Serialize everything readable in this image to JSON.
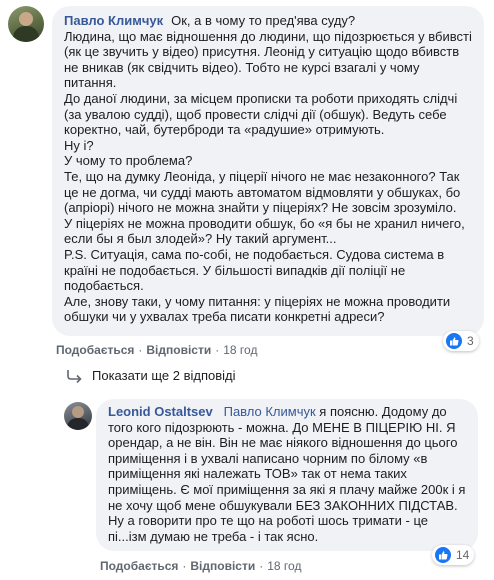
{
  "comment1": {
    "author": "Павло Климчук",
    "text": "Ок, а в чому то пред'ява суду?\nЛюдина, що має відношення до людини, що підозрюється у вбивсті (як це звучить у відео) присутня. Леонід у ситуацію щодо вбивств не вникав (як свідчить відео). Тобто не курсі взагалі у чому питання.\nДо даної людини, за місцем прописки та роботи приходять слідчі (за увалою судді), щоб провести слідчі дії (обшук). Ведуть себе коректно, чай, бутерброди та «радушие» отримують.\nНу і?\nУ чому то проблема?\nТе, що на думку Леоніда, у піцерії нічого не має незаконного? Так це не догма, чи судді мають автоматом відмовляти у обшуках, бо (апріорі) нічого не можна знайти у піцеріях? Не зовсім зрозуміло.\nУ піцеріях не можна проводити обшук, бо «я бы не хранил ничего, если бы я был злодей»? Ну такий аргумент...\nP.S. Ситуація, сама по-собі, не подобається. Судова система в країні не подобається. У більшості випадків дії поліції не подобається.\nАле, знову таки, у чому питання: у піцеріях не можна проводити обшуки чи у ухвалах треба писати конкретні адреси?",
    "like": "Подобається",
    "reply": "Відповісти",
    "time": "18 год",
    "reaction_count": "3"
  },
  "replies_link": "Показати ще 2 відповіді",
  "comment2": {
    "author": "Leonid Ostaltsev",
    "mention": "Павло Климчук",
    "text": "я поясню. Додому до того кого підозрюють - можна. До МЕНЕ В ПІЦЕРІЮ НІ. Я орендар, а не він. Він не має ніякого відношення до цього приміщення і в ухвалі написано чорним по білому «в приміщення які належать ТОВ» так от нема таких приміщень. Є мої приміщення за які я плачу майже 200к і я не хочу щоб мене обшукували БЕЗ ЗАКОННИХ ПІДСТАВ. Ну а говорити про те що на роботі шось тримати - це пі...ізм думаю не треба - і так ясно.",
    "like": "Подобається",
    "reply": "Відповісти",
    "time": "18 год",
    "reaction_count": "14"
  },
  "colors": {
    "bubble": "#f0f2f5",
    "author": "#385898",
    "like_blue": "#1877f2",
    "meta": "#606770"
  }
}
